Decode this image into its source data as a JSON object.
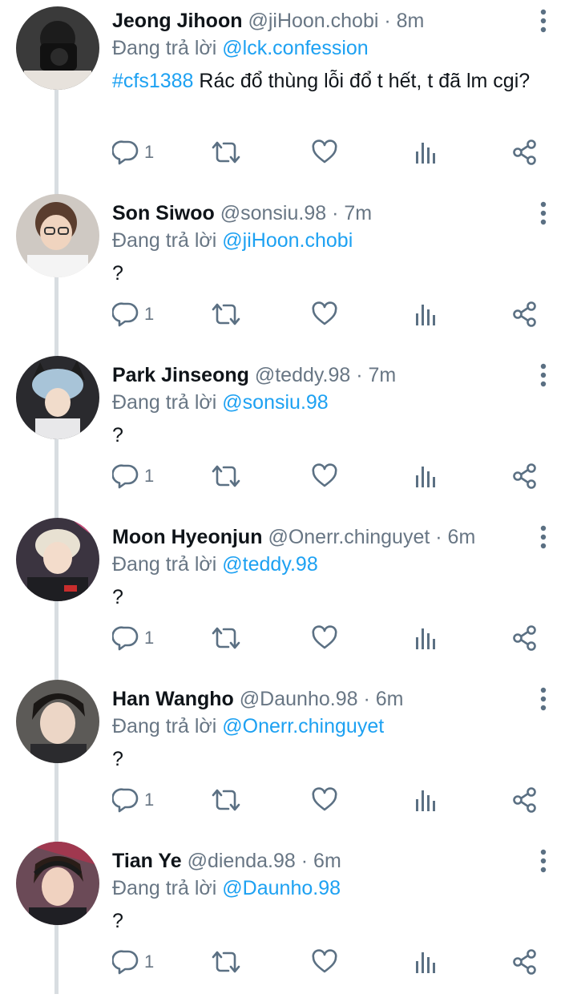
{
  "reply_prefix": "Đang trả lời",
  "tweets": [
    {
      "name": "Jeong Jihoon",
      "handle": "@jiHoon.chobi",
      "time": "· 8m",
      "reply_to": "@lck.confession",
      "hashtag": "#cfs1388",
      "text": " Rác đổ thùng lỗi đổ t hết, t đã lm cgi?",
      "reply_count": "1"
    },
    {
      "name": "Son Siwoo",
      "handle": "@sonsiu.98",
      "time": "· 7m",
      "reply_to": "@jiHoon.chobi",
      "text": "?",
      "reply_count": "1"
    },
    {
      "name": "Park Jinseong",
      "handle": "@teddy.98",
      "time": "· 7m",
      "reply_to": "@sonsiu.98",
      "text": "?",
      "reply_count": "1"
    },
    {
      "name": "Moon Hyeonjun",
      "handle": "@Onerr.chinguyet",
      "time": "· 6m",
      "reply_to": "@teddy.98",
      "text": "?",
      "reply_count": "1"
    },
    {
      "name": "Han Wangho",
      "handle": "@Daunho.98",
      "time": "· 6m",
      "reply_to": "@Onerr.chinguyet",
      "text": "?",
      "reply_count": "1"
    },
    {
      "name": "Tian Ye",
      "handle": "@dienda.98",
      "time": "· 6m",
      "reply_to": "@Daunho.98",
      "text": "?",
      "reply_count": "1"
    }
  ],
  "colors": {
    "accent": "#1da1f2",
    "secondary_text": "#687684",
    "icon": "#5b7083",
    "thread_line": "#d8dde1"
  },
  "icons": [
    "more-vertical-icon",
    "reply-icon",
    "retweet-icon",
    "like-icon",
    "analytics-icon",
    "share-icon"
  ]
}
